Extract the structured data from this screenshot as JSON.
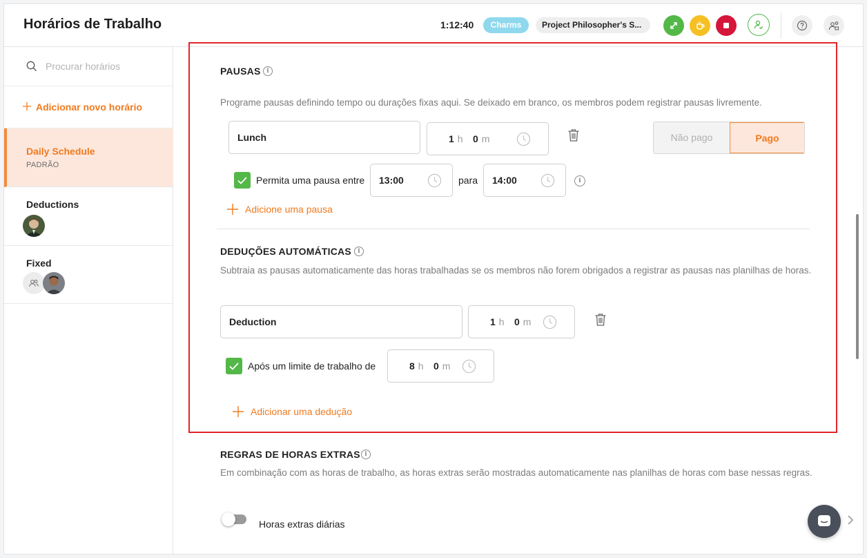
{
  "header": {
    "title": "Horários de Trabalho",
    "timer": "1:12:40",
    "client_pill": "Charms",
    "project_pill": "Project Philosopher's S..."
  },
  "sidebar": {
    "search_placeholder": "Procurar horários",
    "add_label": "Adicionar novo horário",
    "schedules": [
      {
        "name": "Daily Schedule",
        "subtitle": "PADRÃO"
      },
      {
        "name": "Deductions"
      },
      {
        "name": "Fixed"
      }
    ]
  },
  "breaks": {
    "title": "PAUSAS",
    "description": "Programe pausas definindo tempo ou durações fixas aqui. Se deixado em branco, os membros podem registrar pausas livremente.",
    "items": [
      {
        "name": "Lunch",
        "hours": "1",
        "h_unit": "h",
        "minutes": "0",
        "m_unit": "m",
        "unpaid_label": "Não pago",
        "paid_label": "Pago",
        "allow_label": "Permita uma pausa entre",
        "start": "13:00",
        "to_label": "para",
        "end": "14:00"
      }
    ],
    "add_label": "Adicione uma pausa"
  },
  "deductions": {
    "title": "DEDUÇÕES AUTOMÁTICAS",
    "description": "Subtraia as pausas automaticamente das horas trabalhadas se os membros não forem obrigados a registrar as pausas nas planilhas de horas.",
    "items": [
      {
        "name": "Deduction",
        "hours": "1",
        "h_unit": "h",
        "minutes": "0",
        "m_unit": "m",
        "limit_label": "Após um limite de trabalho de",
        "limit_hours": "8",
        "limit_minutes": "0"
      }
    ],
    "add_label": "Adicionar uma dedução"
  },
  "overtime": {
    "title": "REGRAS DE HORAS EXTRAS",
    "description": "Em combinação com as horas de trabalho, as horas extras serão mostradas automaticamente nas planilhas de horas com base nessas regras.",
    "daily_label": "Horas extras diárias"
  },
  "colors": {
    "accent": "#f07a1e",
    "green": "#53b848",
    "highlight": "#e0242a"
  }
}
